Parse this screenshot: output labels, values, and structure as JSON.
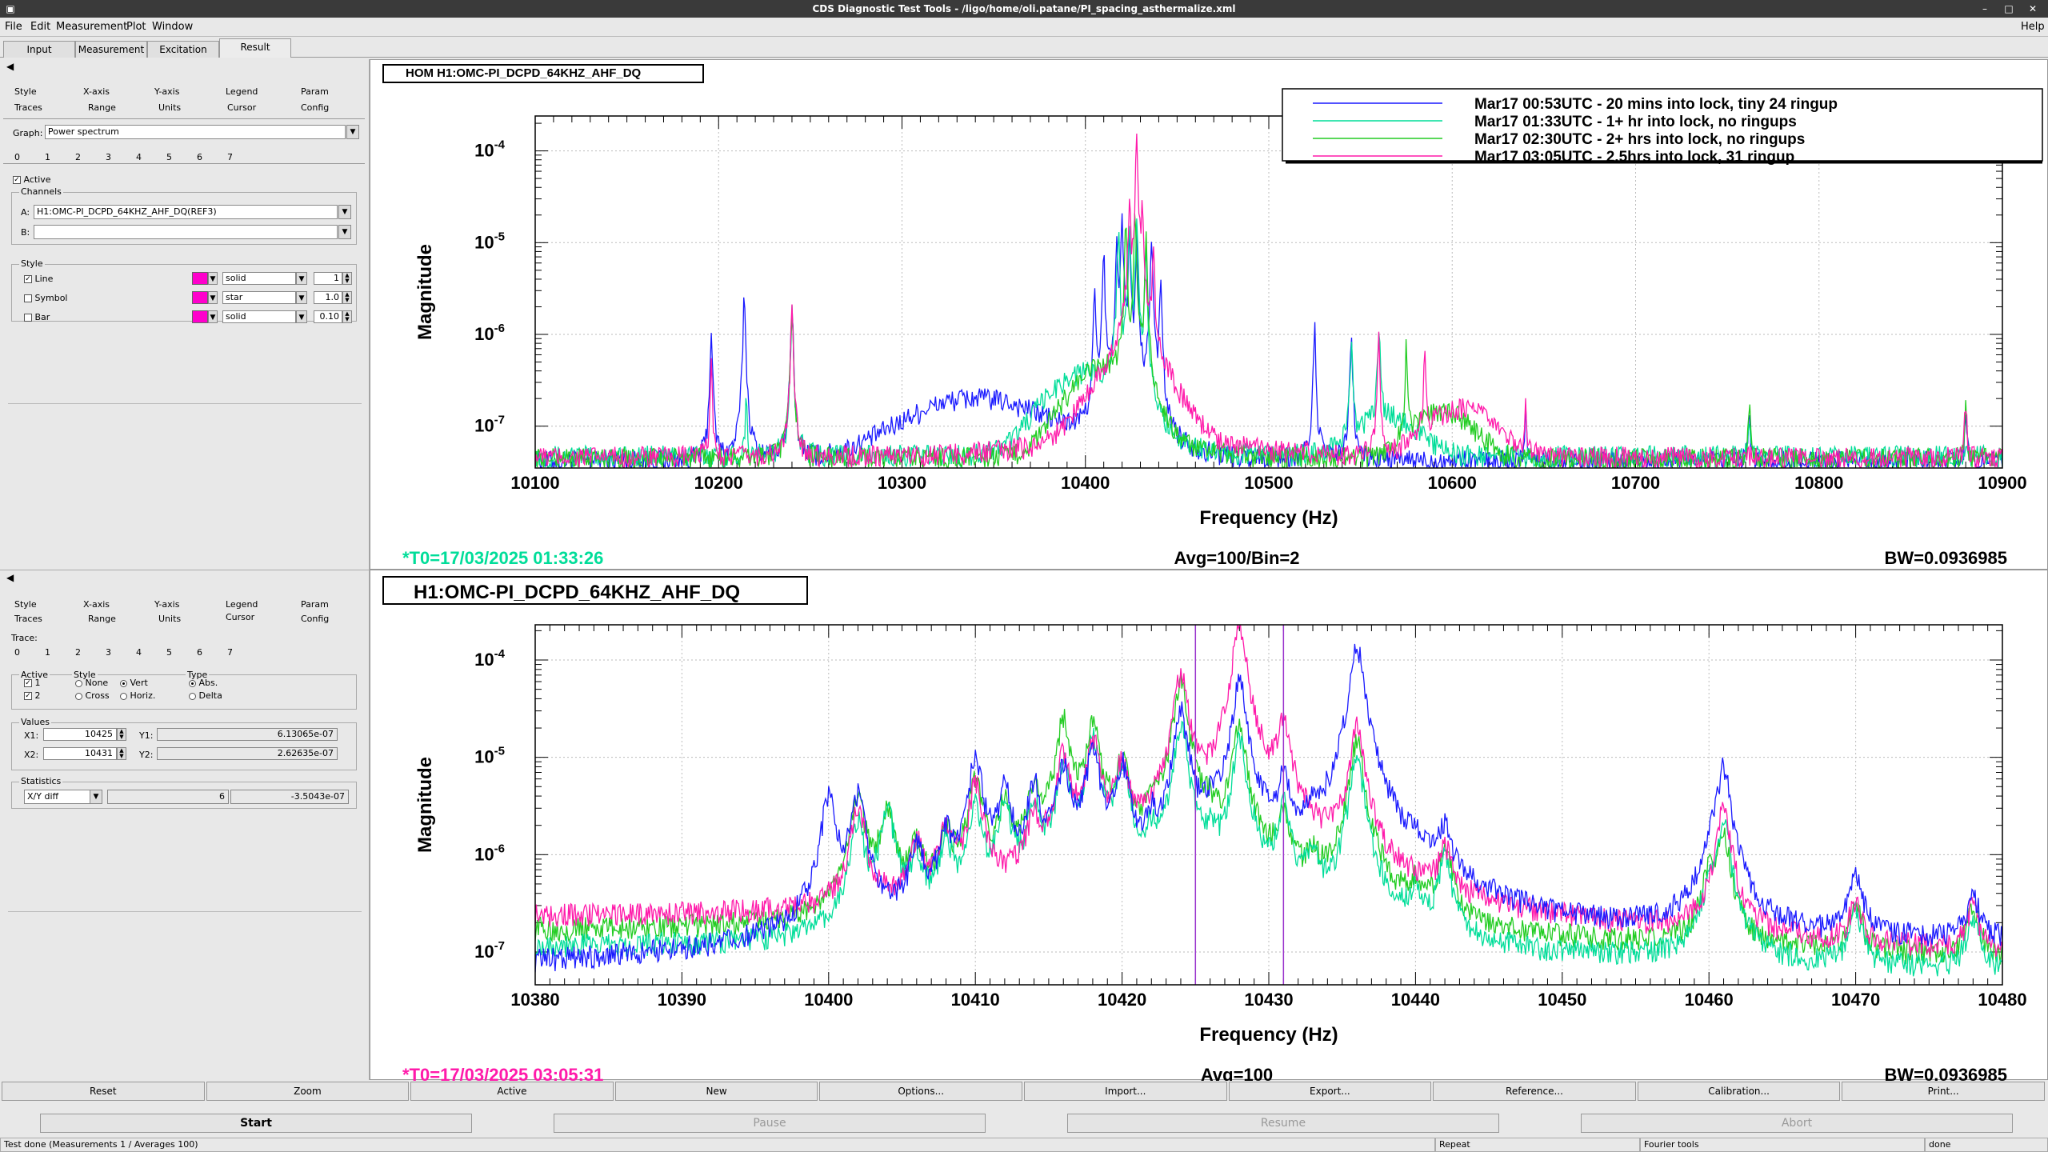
{
  "window": {
    "title": "CDS Diagnostic Test Tools - /ligo/home/oli.patane/PI_spacing_asthermalize.xml"
  },
  "menu": [
    "File",
    "Edit",
    "Measurement",
    "Plot",
    "Window"
  ],
  "help": "Help",
  "main_tabs": [
    "Input",
    "Measurement",
    "Excitation",
    "Result"
  ],
  "panel_top": {
    "tabs_row1": [
      "Style",
      "X-axis",
      "Y-axis",
      "Legend",
      "Param"
    ],
    "tabs_row2": [
      "Traces",
      "Range",
      "Units",
      "Cursor",
      "Config"
    ],
    "graph_label": "Graph:",
    "graph_value": "Power spectrum",
    "trace_tabs": [
      "0",
      "1",
      "2",
      "3",
      "4",
      "5",
      "6",
      "7"
    ],
    "active_label": "Active",
    "channels_label": "Channels",
    "chan_a_label": "A:",
    "chan_a_value": "H1:OMC-PI_DCPD_64KHZ_AHF_DQ(REF3)",
    "chan_b_label": "B:",
    "chan_b_value": "",
    "style_label": "Style",
    "line_label": "Line",
    "symbol_label": "Symbol",
    "bar_label": "Bar",
    "line_style": "solid",
    "symbol_style": "star",
    "bar_style": "solid",
    "line_width": "1",
    "symbol_size": "1.0",
    "bar_width": "0.10",
    "trace_color": "#ff00cc"
  },
  "panel_bottom": {
    "tabs_row1": [
      "Style",
      "X-axis",
      "Y-axis",
      "Legend",
      "Param"
    ],
    "tabs_row2": [
      "Traces",
      "Range",
      "Units",
      "Cursor",
      "Config"
    ],
    "trace_label": "Trace:",
    "trace_tabs": [
      "0",
      "1",
      "2",
      "3",
      "4",
      "5",
      "6",
      "7"
    ],
    "active_label": "Active",
    "active_1": "1",
    "active_2": "2",
    "style_label": "Style",
    "style_none": "None",
    "style_vert": "Vert",
    "style_cross": "Cross",
    "style_horiz": "Horiz.",
    "type_label": "Type",
    "type_abs": "Abs.",
    "type_delta": "Delta",
    "values_label": "Values",
    "x1_label": "X1:",
    "x1_value": "10425",
    "y1_label": "Y1:",
    "y1_value": "6.13065e-07",
    "x2_label": "X2:",
    "x2_value": "10431",
    "y2_label": "Y2:",
    "y2_value": "2.62635e-07",
    "statistics_label": "Statistics",
    "stat_mode": "X/Y diff",
    "stat_dx": "6",
    "stat_dy": "-3.5043e-07"
  },
  "buttons": [
    "Reset",
    "Zoom",
    "Active",
    "New",
    "Options...",
    "Import...",
    "Export...",
    "Reference...",
    "Calibration...",
    "Print..."
  ],
  "start_buttons": [
    "Start",
    "Pause",
    "Resume",
    "Abort"
  ],
  "status": {
    "left": "Test done (Measurements 1 / Averages 100)",
    "repeat": "Repeat",
    "fourier": "Fourier tools",
    "done": "done"
  },
  "colors": {
    "blue": "#1a1aff",
    "cyan": "#00dd99",
    "green": "#22cc22",
    "magenta": "#ff1aaa"
  },
  "chart_data": [
    {
      "type": "line",
      "title": "HOM H1:OMC-PI_DCPD_64KHZ_AHF_DQ",
      "xlabel": "Frequency (Hz)",
      "ylabel": "Magnitude",
      "xlim": [
        10100,
        10900
      ],
      "ylim": [
        3.5e-08,
        0.00024
      ],
      "yscale": "log",
      "grid": true,
      "x_ticks": [
        10100,
        10200,
        10300,
        10400,
        10500,
        10600,
        10700,
        10800,
        10900
      ],
      "y_ticks": [
        {
          "v": 1e-07,
          "label": "10",
          "exp": "-7"
        },
        {
          "v": 1e-06,
          "label": "10",
          "exp": "-6"
        },
        {
          "v": 1e-05,
          "label": "10",
          "exp": "-5"
        },
        {
          "v": 0.0001,
          "label": "10",
          "exp": "-4"
        }
      ],
      "legend_position": "top-right",
      "footer_left": "*T0=17/03/2025 01:33:26",
      "footer_left_color": "#00dd99",
      "footer_center": "Avg=100/Bin=2",
      "footer_right": "BW=0.0936985",
      "series": [
        {
          "name": "Mar17 00:53UTC - 20 mins into lock, tiny 24 ringup",
          "color": "#1a1aff",
          "floor": 4.2e-08,
          "bumps": [
            [
              10340,
              1.6e-07,
              45
            ]
          ],
          "peaks": [
            [
              10196,
              1.2e-06
            ],
            [
              10214,
              3e-06
            ],
            [
              10240,
              2.2e-06
            ],
            [
              10405,
              3e-06
            ],
            [
              10410,
              8e-06
            ],
            [
              10417,
              1e-05
            ],
            [
              10420,
              2e-05
            ],
            [
              10424,
              1.2e-05
            ],
            [
              10428,
              1.2e-05
            ],
            [
              10436,
              1.2e-05
            ],
            [
              10441,
              4e-06
            ],
            [
              10525,
              1.2e-06
            ],
            [
              10545,
              1.1e-06
            ],
            [
              10640,
              1.2e-07
            ],
            [
              10762,
              1e-07
            ],
            [
              10880,
              1e-07
            ]
          ]
        },
        {
          "name": "Mar17 01:33UTC - 1+ hr into lock, no ringups",
          "color": "#00dd99",
          "floor": 4.8e-08,
          "bumps": [
            [
              10400,
              3.2e-07,
              25
            ],
            [
              10565,
              8e-08,
              20
            ]
          ],
          "peaks": [
            [
              10215,
              1.5e-07
            ],
            [
              10240,
              2e-06
            ],
            [
              10418,
              1.5e-05
            ],
            [
              10424,
              2e-05
            ],
            [
              10428,
              1.5e-05
            ],
            [
              10433,
              8e-06
            ],
            [
              10545,
              9e-07
            ],
            [
              10560,
              1.2e-06
            ],
            [
              10762,
              9e-08
            ]
          ]
        },
        {
          "name": "Mar17 02:30UTC - 2+ hrs into lock, no ringups",
          "color": "#22cc22",
          "floor": 4.5e-08,
          "bumps": [
            [
              10410,
              3.8e-07,
              22
            ],
            [
              10595,
              1e-07,
              20
            ]
          ],
          "peaks": [
            [
              10240,
              2e-06
            ],
            [
              10422,
              1.5e-05
            ],
            [
              10427,
              2.2e-05
            ],
            [
              10433,
              1.2e-05
            ],
            [
              10575,
              8e-07
            ],
            [
              10762,
              1.5e-07
            ],
            [
              10880,
              1.5e-07
            ]
          ]
        },
        {
          "name": "Mar17 03:05UTC - 2.5hrs into lock, 31 ringup",
          "color": "#ff1aaa",
          "floor": 4.6e-08,
          "bumps": [
            [
              10425,
              4e-07,
              22
            ],
            [
              10605,
              1.1e-07,
              22
            ]
          ],
          "peaks": [
            [
              10196,
              4e-07
            ],
            [
              10240,
              2e-06
            ],
            [
              10424,
              3e-05
            ],
            [
              10428,
              0.00015
            ],
            [
              10431,
              2e-05
            ],
            [
              10437,
              1e-05
            ],
            [
              10560,
              8e-07
            ],
            [
              10585,
              5e-07
            ],
            [
              10640,
              1.1e-07
            ],
            [
              10880,
              1.5e-07
            ]
          ]
        }
      ]
    },
    {
      "type": "line",
      "title": "H1:OMC-PI_DCPD_64KHZ_AHF_DQ",
      "xlabel": "Frequency (Hz)",
      "ylabel": "Magnitude",
      "xlim": [
        10380,
        10480
      ],
      "ylim": [
        4.6e-08,
        0.00023
      ],
      "yscale": "log",
      "grid": true,
      "x_ticks": [
        10380,
        10390,
        10400,
        10410,
        10420,
        10430,
        10440,
        10450,
        10460,
        10470,
        10480
      ],
      "y_ticks": [
        {
          "v": 1e-07,
          "label": "10",
          "exp": "-7"
        },
        {
          "v": 1e-06,
          "label": "10",
          "exp": "-6"
        },
        {
          "v": 1e-05,
          "label": "10",
          "exp": "-5"
        },
        {
          "v": 0.0001,
          "label": "10",
          "exp": "-4"
        }
      ],
      "cursors": [
        10425,
        10431
      ],
      "cursor_color": "#9933cc",
      "footer_left": "*T0=17/03/2025 03:05:31",
      "footer_left_color": "#ff1aaa",
      "footer_center": "Avg=100",
      "footer_right": "BW=0.0936985",
      "series": [
        {
          "name": "Mar17 02:30UTC - 2+ hrs into lock, no ringups",
          "color": "#22cc22",
          "floor_start": 1.6e-07,
          "floor_end": 8e-08,
          "peaks": [
            [
              10402,
              4e-06
            ],
            [
              10404,
              3e-06
            ],
            [
              10406,
              1e-06
            ],
            [
              10408,
              1.5e-06
            ],
            [
              10410,
              6e-06
            ],
            [
              10412,
              3e-06
            ],
            [
              10414,
              4e-06
            ],
            [
              10416,
              2.5e-05
            ],
            [
              10418,
              2.2e-05
            ],
            [
              10420,
              1e-05
            ],
            [
              10422,
              1.5e-06
            ],
            [
              10424,
              6e-05
            ],
            [
              10426,
              1.5e-06
            ],
            [
              10428,
              2e-05
            ],
            [
              10431,
              2.5e-06
            ],
            [
              10433,
              6e-07
            ],
            [
              10436,
              1.5e-05
            ],
            [
              10440,
              3e-07
            ],
            [
              10442,
              1e-06
            ],
            [
              10460,
              5e-07
            ],
            [
              10461,
              1.5e-06
            ],
            [
              10470,
              2e-07
            ],
            [
              10478,
              2e-07
            ]
          ]
        },
        {
          "name": "Mar17 01:33UTC - 1+ hr into lock, no ringups",
          "color": "#00dd99",
          "floor_start": 1.1e-07,
          "floor_end": 6e-08,
          "peaks": [
            [
              10402,
              2e-06
            ],
            [
              10404,
              3e-06
            ],
            [
              10406,
              8e-07
            ],
            [
              10408,
              1.2e-06
            ],
            [
              10410,
              3e-06
            ],
            [
              10412,
              3e-06
            ],
            [
              10414,
              3e-06
            ],
            [
              10416,
              8e-06
            ],
            [
              10418,
              1.6e-05
            ],
            [
              10420,
              8e-06
            ],
            [
              10422,
              1e-06
            ],
            [
              10424,
              2e-05
            ],
            [
              10426,
              1e-06
            ],
            [
              10428,
              1.5e-05
            ],
            [
              10431,
              3e-06
            ],
            [
              10433,
              8e-07
            ],
            [
              10436,
              1e-05
            ],
            [
              10440,
              3e-07
            ],
            [
              10442,
              8e-07
            ],
            [
              10460,
              3e-07
            ],
            [
              10461,
              2e-06
            ],
            [
              10470,
              2e-07
            ],
            [
              10478,
              1.8e-07
            ]
          ]
        },
        {
          "name": "Mar17 03:05UTC - 2.5hrs into lock, 31 ringup",
          "color": "#ff1aaa",
          "floor_start": 2.2e-07,
          "floor_end": 8e-08,
          "peaks": [
            [
              10402,
              3e-06
            ],
            [
              10406,
              1e-06
            ],
            [
              10408,
              1.5e-06
            ],
            [
              10410,
              5e-06
            ],
            [
              10414,
              2e-06
            ],
            [
              10416,
              1e-05
            ],
            [
              10418,
              1.5e-05
            ],
            [
              10420,
              8e-06
            ],
            [
              10424,
              7e-05
            ],
            [
              10428,
              0.00023
            ],
            [
              10431,
              2.2e-05
            ],
            [
              10436,
              2e-05
            ],
            [
              10442,
              8e-07
            ],
            [
              10461,
              3e-06
            ],
            [
              10470,
              2e-07
            ],
            [
              10478,
              2e-07
            ]
          ]
        },
        {
          "name": "Mar17 00:53UTC - 20 mins into lock, tiny 24 ringup",
          "color": "#1a1aff",
          "floor_start": 6e-08,
          "floor_end": 1.2e-07,
          "peaks": [
            [
              10400,
              4e-06
            ],
            [
              10402,
              4e-06
            ],
            [
              10406,
              1e-06
            ],
            [
              10408,
              1.4e-06
            ],
            [
              10410,
              1e-05
            ],
            [
              10412,
              4.5e-06
            ],
            [
              10414,
              5e-06
            ],
            [
              10416,
              8e-06
            ],
            [
              10418,
              1.2e-05
            ],
            [
              10420,
              8e-06
            ],
            [
              10422,
              1.4e-06
            ],
            [
              10424,
              3e-05
            ],
            [
              10426,
              1.5e-06
            ],
            [
              10428,
              6e-05
            ],
            [
              10431,
              5e-06
            ],
            [
              10433,
              1e-06
            ],
            [
              10436,
              0.00014
            ],
            [
              10440,
              3e-07
            ],
            [
              10442,
              1.3e-06
            ],
            [
              10460,
              8e-07
            ],
            [
              10461,
              8e-06
            ],
            [
              10470,
              5e-07
            ],
            [
              10478,
              2.5e-07
            ]
          ]
        }
      ]
    }
  ]
}
